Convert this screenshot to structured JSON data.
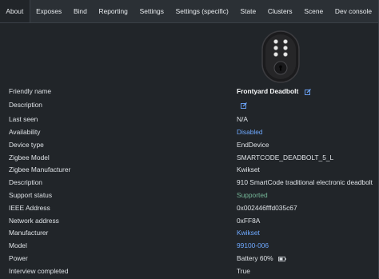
{
  "tabs": [
    {
      "label": "About",
      "active": true
    },
    {
      "label": "Exposes"
    },
    {
      "label": "Bind"
    },
    {
      "label": "Reporting"
    },
    {
      "label": "Settings"
    },
    {
      "label": "Settings (specific)"
    },
    {
      "label": "State"
    },
    {
      "label": "Clusters"
    },
    {
      "label": "Scene"
    },
    {
      "label": "Dev console"
    }
  ],
  "device": {
    "image_icon": "deadbolt-lock-image",
    "rows": {
      "friendly_name": {
        "label": "Friendly name",
        "value": "Frontyard Deadbolt"
      },
      "description_edit": {
        "label": "Description"
      },
      "last_seen": {
        "label": "Last seen",
        "value": "N/A"
      },
      "availability": {
        "label": "Availability",
        "value": "Disabled"
      },
      "device_type": {
        "label": "Device type",
        "value": "EndDevice"
      },
      "zigbee_model": {
        "label": "Zigbee Model",
        "value": "SMARTCODE_DEADBOLT_5_L"
      },
      "zigbee_manufacturer": {
        "label": "Zigbee Manufacturer",
        "value": "Kwikset"
      },
      "description": {
        "label": "Description",
        "value": "910 SmartCode traditional electronic deadbolt"
      },
      "support_status": {
        "label": "Support status",
        "value": "Supported"
      },
      "ieee_address": {
        "label": "IEEE Address",
        "value": "0x002446fffd035c67"
      },
      "network_address": {
        "label": "Network address",
        "value": "0xFF8A"
      },
      "manufacturer": {
        "label": "Manufacturer",
        "value": "Kwikset"
      },
      "model": {
        "label": "Model",
        "value": "99100-006"
      },
      "power": {
        "label": "Power",
        "value": "Battery 60%",
        "battery_icon": "battery-icon"
      },
      "interview_completed": {
        "label": "Interview completed",
        "value": "True"
      }
    }
  },
  "colors": {
    "background": "#212529",
    "nav": "#2b3035",
    "link": "#6ea8fe",
    "success": "#75b798"
  }
}
